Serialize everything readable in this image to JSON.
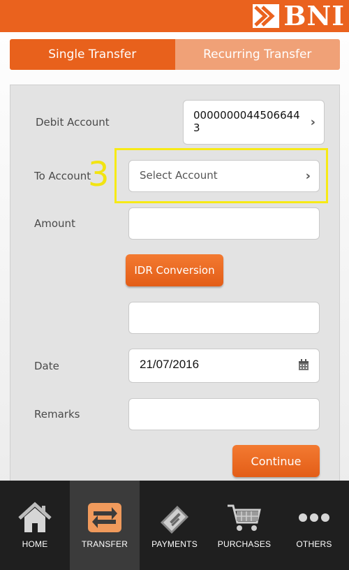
{
  "header": {
    "brand": "BNI"
  },
  "tabs": [
    {
      "label": "Single Transfer",
      "active": true
    },
    {
      "label": "Recurring Transfer",
      "active": false
    }
  ],
  "form": {
    "debit_account_label": "Debit Account",
    "debit_account_value": "00000000445066443",
    "to_account_label": "To Account",
    "to_account_placeholder": "Select Account",
    "step_number": "3",
    "amount_label": "Amount",
    "amount_value": "",
    "idr_conversion_label": "IDR Conversion",
    "conversion_value": "",
    "date_label": "Date",
    "date_value": "21/07/2016",
    "remarks_label": "Remarks",
    "remarks_value": "",
    "continue_label": "Continue"
  },
  "bottom_nav": [
    {
      "label": "HOME",
      "icon": "home-icon",
      "active": false
    },
    {
      "label": "TRANSFER",
      "icon": "transfer-icon",
      "active": true
    },
    {
      "label": "PAYMENTS",
      "icon": "payments-icon",
      "active": false
    },
    {
      "label": "PURCHASES",
      "icon": "cart-icon",
      "active": false
    },
    {
      "label": "OTHERS",
      "icon": "more-icon",
      "active": false
    }
  ],
  "colors": {
    "brand_orange": "#ea621e",
    "tab_inactive": "#f0a177",
    "highlight_yellow": "#f7ea16",
    "nav_background": "#1f1f1f"
  }
}
